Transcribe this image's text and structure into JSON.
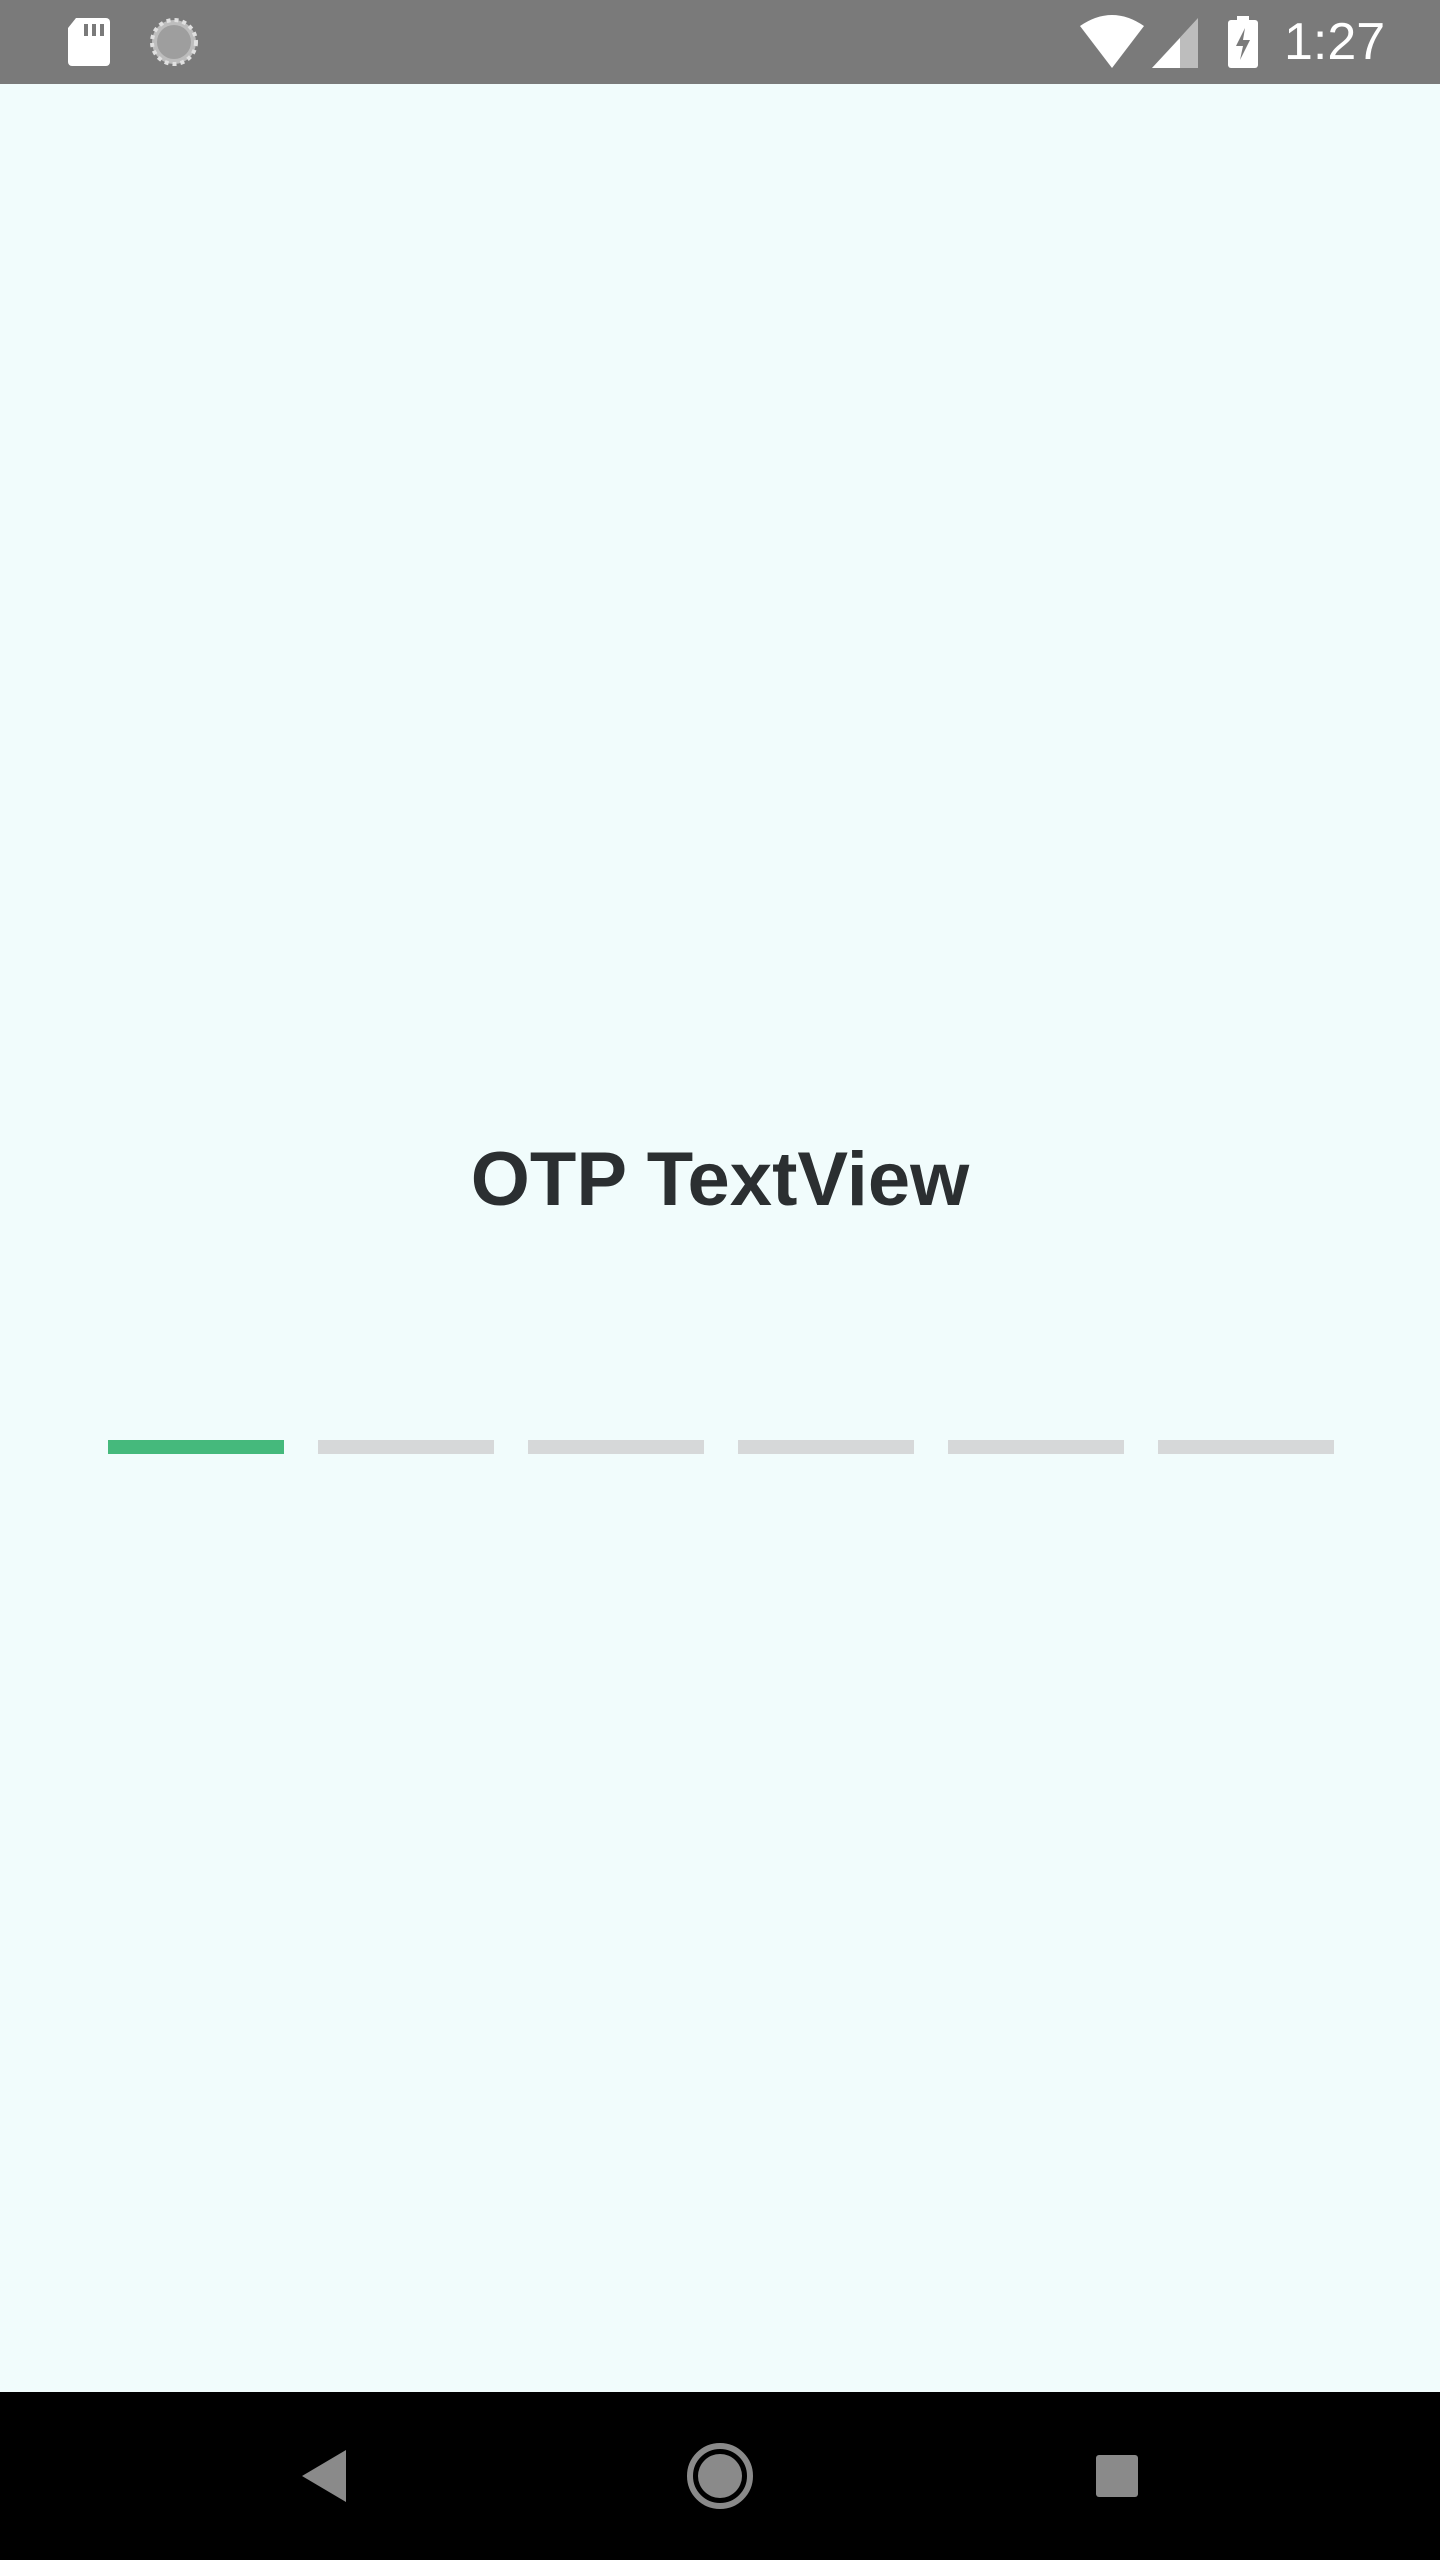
{
  "status_bar": {
    "time": "1:27",
    "left_icons": [
      "sd-card-icon",
      "sync-icon"
    ],
    "right_icons": [
      "wifi-icon",
      "cell-signal-icon",
      "battery-charging-icon"
    ],
    "background_color": "#7a7a7a"
  },
  "screen": {
    "title": "OTP TextView",
    "background_color": "#f1fcfc",
    "title_color": "#2b2f31"
  },
  "otp": {
    "length": 6,
    "active_index": 0,
    "active_color": "#45b97c",
    "inactive_color": "#d6d8d9",
    "digits": [
      "",
      "",
      "",
      "",
      "",
      ""
    ]
  },
  "nav_bar": {
    "buttons": [
      "back-icon",
      "home-icon",
      "recents-icon"
    ],
    "icon_color": "#8a8a8a"
  }
}
